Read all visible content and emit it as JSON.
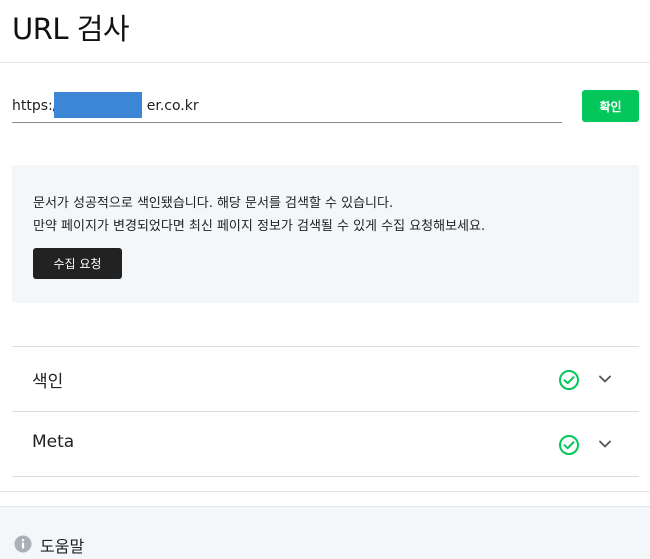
{
  "page": {
    "title": "URL 검사"
  },
  "url_form": {
    "value": "https://                   er.co.kr",
    "confirm_label": "확인"
  },
  "notice": {
    "line1": "문서가 성공적으로 색인됐습니다. 해당 문서를 검색할 수 있습니다.",
    "line2": "만약 페이지가 변경되었다면 최신 페이지 정보가 검색될 수 있게 수집 요청해보세요.",
    "request_label": "수집 요청"
  },
  "sections": [
    {
      "label": "색인",
      "status": "ok"
    },
    {
      "label": "Meta",
      "status": "ok"
    }
  ],
  "help": {
    "label": "도움말"
  },
  "colors": {
    "accent": "#03c75a",
    "check": "#03c75a",
    "mask": "#3d86d6",
    "dark_button": "#222222",
    "panel_bg": "#f3f7fa"
  }
}
